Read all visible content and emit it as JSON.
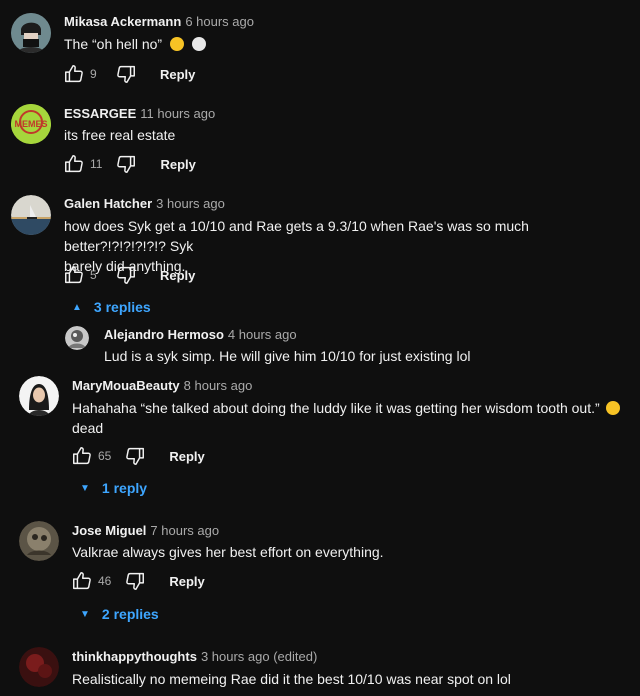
{
  "comments": [
    {
      "author": "Mikasa Ackermann",
      "time": "6 hours ago",
      "text": "The “oh hell no”",
      "likes": "9",
      "reply_label": "Reply"
    },
    {
      "author": "ESSARGEE",
      "time": "11 hours ago",
      "text": "its free real estate",
      "likes": "11",
      "reply_label": "Reply"
    },
    {
      "author": "Galen Hatcher",
      "time": "3 hours ago",
      "text_line1": "how does Syk get a 10/10 and Rae gets a 9.3/10 when Rae's was so much better?!?!?!?!?!? Syk",
      "text_line2": "barely did anything.",
      "likes": "5",
      "reply_label": "Reply",
      "replies_label": "3 replies"
    },
    {
      "author": "Alejandro Hermoso",
      "time": "4 hours ago",
      "text": "Lud is a syk simp. He will give him 10/10 for just existing lol"
    },
    {
      "author": "MaryMouaBeauty",
      "time": "8 hours ago",
      "text_line1": "Hahahaha “she talked about doing the luddy like it was getting her wisdom tooth out.”",
      "text_line2": "dead",
      "likes": "65",
      "reply_label": "Reply",
      "replies_label": "1 reply"
    },
    {
      "author": "Jose Miguel",
      "time": "7 hours ago",
      "text": "Valkrae always gives her best effort on everything.",
      "likes": "46",
      "reply_label": "Reply",
      "replies_label": "2 replies"
    },
    {
      "author": "thinkhappythoughts",
      "time": "3 hours ago (edited)",
      "text": "Realistically no memeing Rae did it the best 10/10 was near spot on lol"
    }
  ],
  "avatar_logo_text": "MEMES",
  "colors": {
    "background": "#0f0f0f",
    "text": "#f1f1f1",
    "secondary": "#aaaaaa",
    "link": "#3ea6ff"
  }
}
